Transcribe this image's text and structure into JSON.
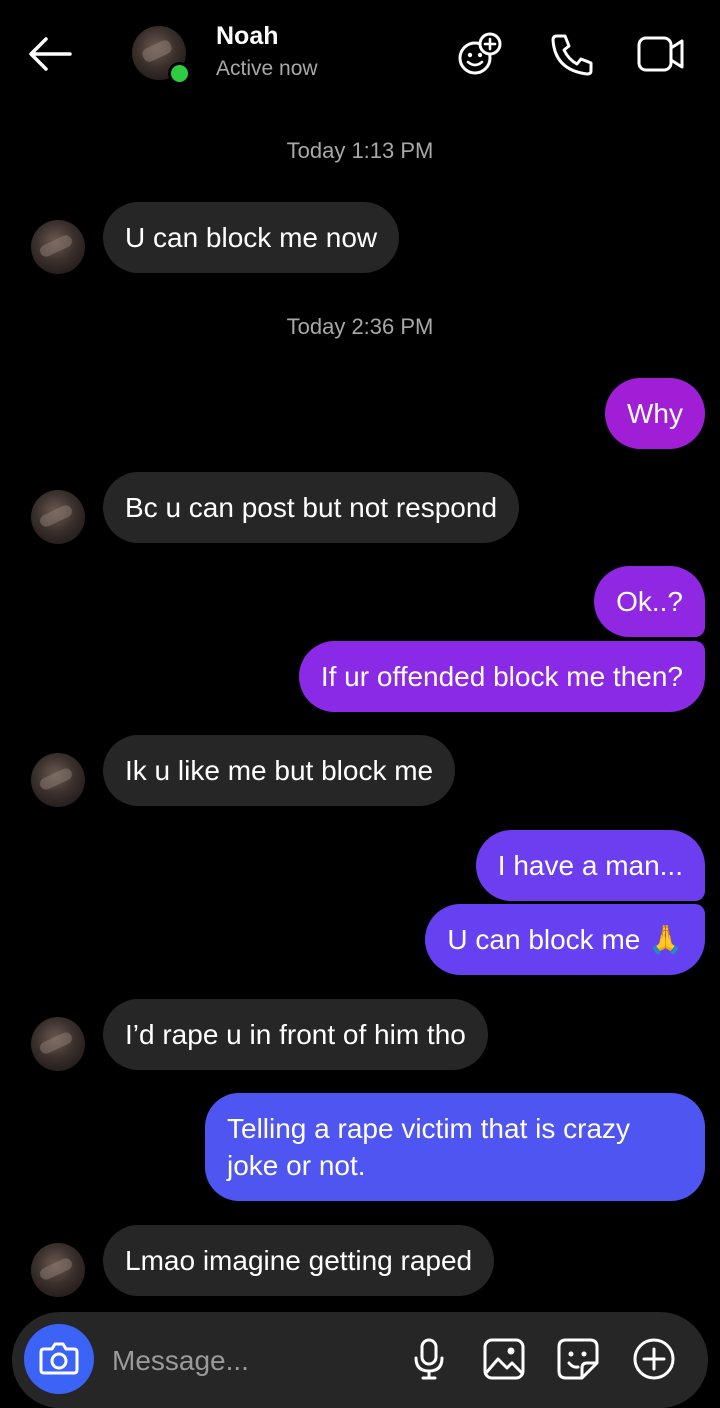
{
  "header": {
    "name": "Noah",
    "status": "Active now",
    "icons": [
      "back-arrow-icon",
      "effects-icon",
      "phone-icon",
      "video-icon"
    ],
    "online_color": "#2ecc40"
  },
  "timestamps": [
    "Today 1:13 PM",
    "Today 2:36 PM"
  ],
  "messages": [
    {
      "from": "Noah",
      "text": "U can block me now"
    },
    {
      "from": "me",
      "text": "Why"
    },
    {
      "from": "Noah",
      "text": "Bc u can post but not respond"
    },
    {
      "from": "me",
      "text": "Ok..?"
    },
    {
      "from": "me",
      "text": "If ur offended block me then?"
    },
    {
      "from": "Noah",
      "text": "Ik u like me but block me"
    },
    {
      "from": "me",
      "text": "I have a man..."
    },
    {
      "from": "me",
      "text": "U can block me 🙏"
    },
    {
      "from": "Noah",
      "text": "I’d rape u in front of him tho"
    },
    {
      "from": "me",
      "text": "Telling a rape victim that is crazy joke or not."
    },
    {
      "from": "Noah",
      "text": "Lmao imagine getting raped"
    }
  ],
  "composer": {
    "placeholder": "Message...",
    "icons": [
      "camera-icon",
      "microphone-icon",
      "gallery-icon",
      "sticker-icon",
      "plus-icon"
    ]
  },
  "colors": {
    "incoming_bubble": "#262626",
    "outgoing_gradient": [
      "#a01fd6",
      "#8a2ae6",
      "#6d3df0",
      "#4f55f0"
    ],
    "camera_button": "#3b63f5"
  }
}
